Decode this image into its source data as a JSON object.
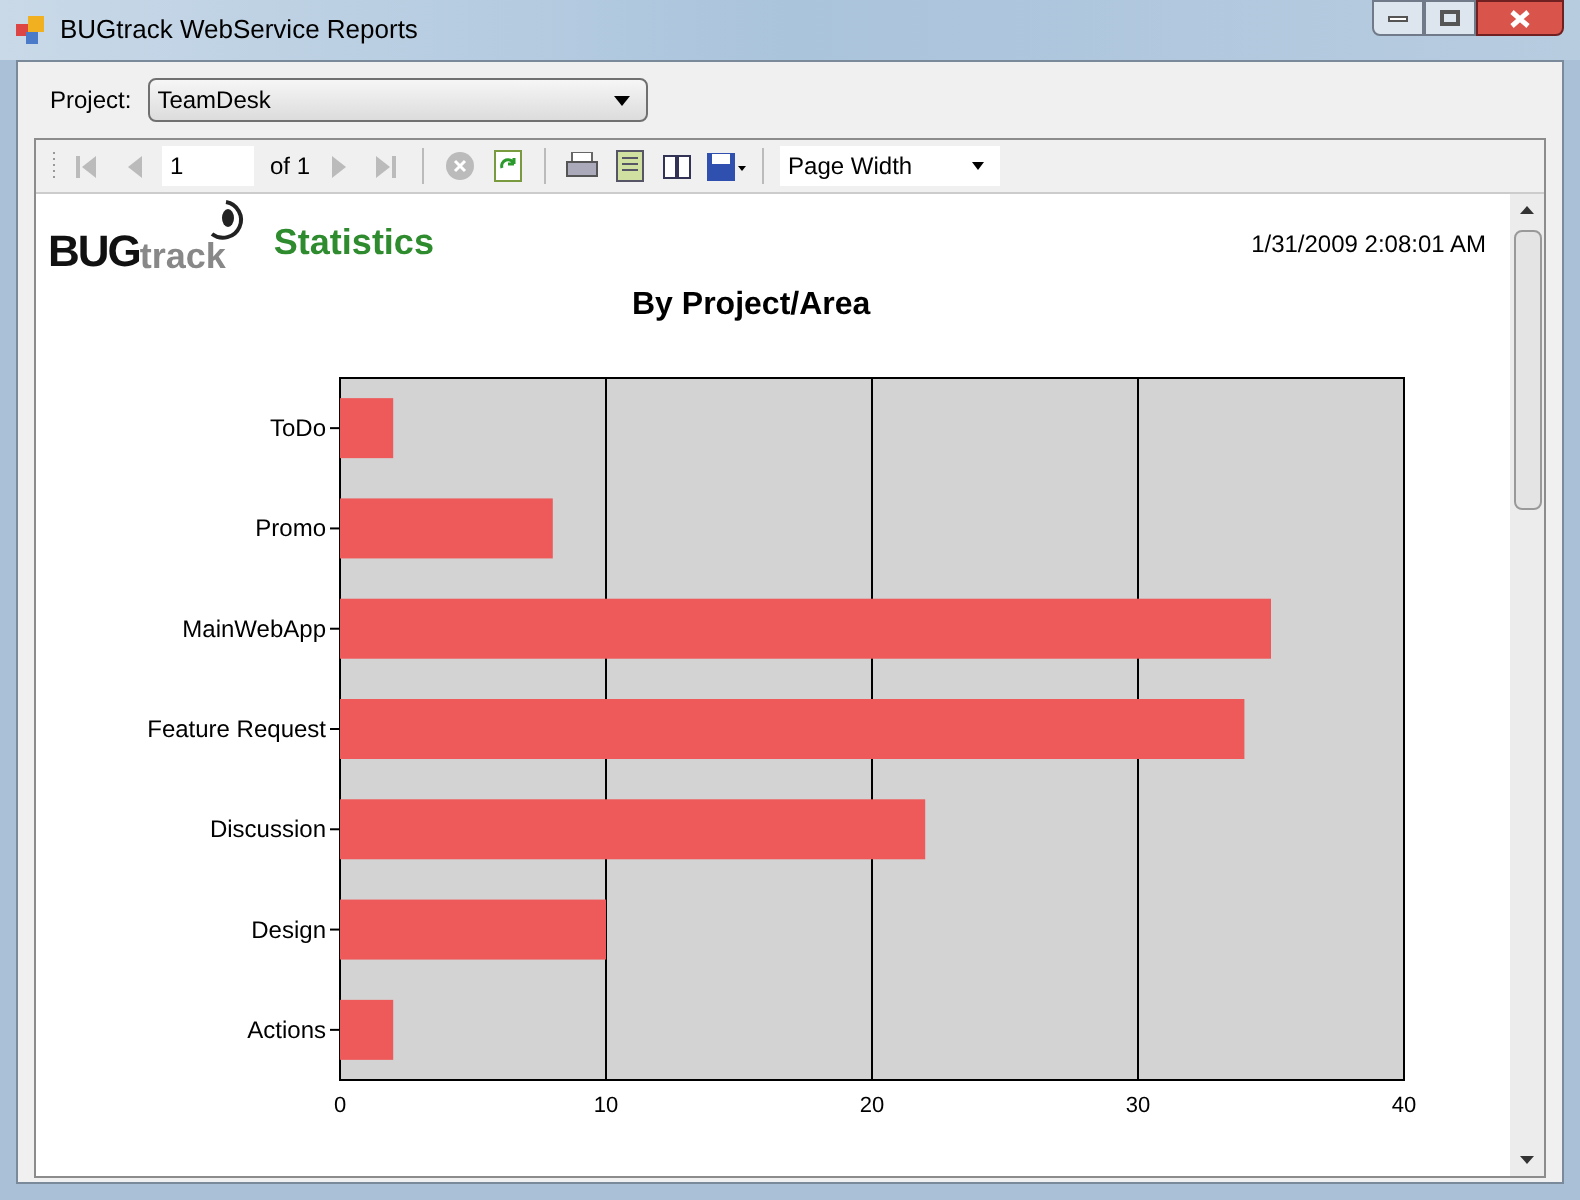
{
  "window": {
    "title": "BUGtrack WebService Reports"
  },
  "project": {
    "label": "Project:",
    "value": "TeamDesk"
  },
  "toolbar": {
    "page": "1",
    "of_label": "of",
    "page_count": "1",
    "zoom": "Page Width"
  },
  "report": {
    "logo_bold": "BUG",
    "logo_light": "track",
    "title": "Statistics",
    "timestamp": "1/31/2009 2:08:01 AM",
    "chart_data": {
      "type": "bar",
      "orientation": "horizontal",
      "grid": true,
      "title": "By Project/Area",
      "categories": [
        "ToDo",
        "Promo",
        "MainWebApp",
        "Feature Request",
        "Discussion",
        "Design",
        "Actions"
      ],
      "series": [
        {
          "color": "#ee5a5a",
          "values": [
            2,
            8,
            35,
            34,
            22,
            10,
            2
          ]
        }
      ],
      "xlim": [
        0,
        40
      ],
      "xticks": [
        0,
        10,
        20,
        30,
        40
      ]
    }
  }
}
